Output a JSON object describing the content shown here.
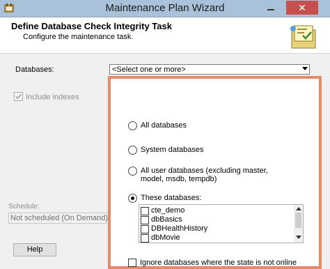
{
  "window": {
    "title": "Maintenance Plan Wizard",
    "close_glyph": "✕"
  },
  "header": {
    "title": "Define Database Check Integrity Task",
    "subtitle": "Configure the maintenance task."
  },
  "form": {
    "databases_label": "Databases:",
    "databases_value": "<Select one or more>",
    "include_indexes_label": "Include indexes",
    "include_indexes_checked": true,
    "include_indexes_enabled": false,
    "schedule_label": "Schedule:",
    "schedule_value": "Not scheduled (On Demand)",
    "help_label": "Help"
  },
  "dropdown": {
    "options": [
      {
        "label": "All databases",
        "selected": false
      },
      {
        "label": "System databases",
        "selected": false
      },
      {
        "label": "All user databases  (excluding master, model, msdb, tempdb)",
        "selected": false
      },
      {
        "label": "These databases:",
        "selected": true
      }
    ],
    "database_list": [
      {
        "name": "cte_demo",
        "checked": false
      },
      {
        "name": "dbBasics",
        "checked": false
      },
      {
        "name": "DBHealthHistory",
        "checked": false
      },
      {
        "name": "dbMovie",
        "checked": false
      }
    ],
    "ignore_offline_label": "Ignore databases where the state is not online",
    "ignore_offline_checked": false
  },
  "colors": {
    "titlebar": "#a9c2da",
    "close_button": "#c7504f",
    "highlight_border": "#e58a6a"
  }
}
